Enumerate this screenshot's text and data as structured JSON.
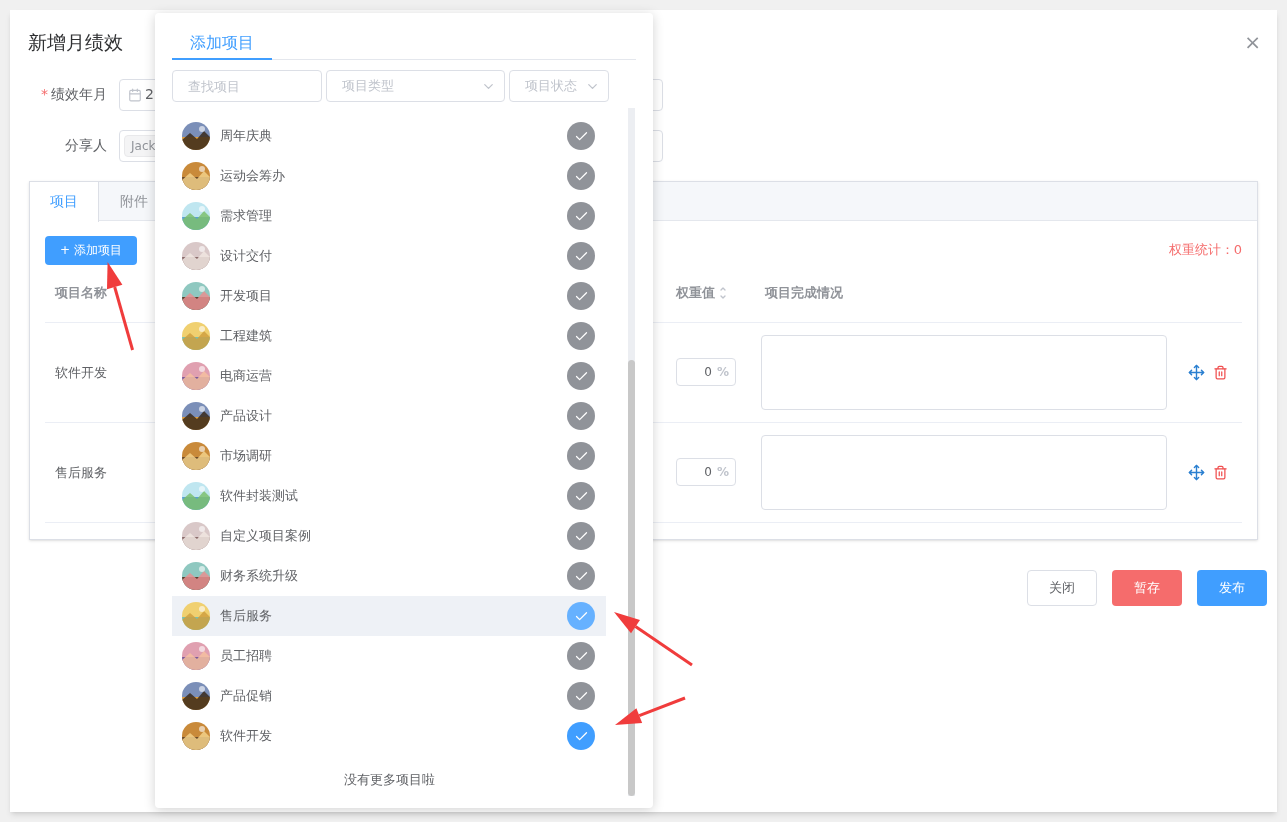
{
  "dialog": {
    "title": "新增月绩效",
    "close": "×"
  },
  "form": {
    "fields": [
      {
        "label": "绩效年月",
        "required_mark": "*",
        "kind": "date",
        "value": "2"
      },
      {
        "label": "分享人",
        "kind": "tags",
        "tags": [
          "Jack"
        ]
      }
    ]
  },
  "tabs": [
    {
      "label": "项目",
      "selected": true
    },
    {
      "label": "附件",
      "selected": false
    }
  ],
  "add_button": "添加项目",
  "add_icon": "+",
  "weight_total": "权重统计：0",
  "table": {
    "columns": [
      {
        "label": "项目名称",
        "sortable": false
      },
      {
        "label": "权重值",
        "sortable": true
      },
      {
        "label": "项目完成情况",
        "sortable": false
      }
    ],
    "rows": [
      {
        "name": "软件开发",
        "weight": "0",
        "unit": "%"
      },
      {
        "name": "售后服务",
        "weight": "0",
        "unit": "%"
      }
    ]
  },
  "footer": [
    {
      "label": "关闭",
      "kind": "default"
    },
    {
      "label": "暂存",
      "kind": "danger"
    },
    {
      "label": "发布",
      "kind": "primary"
    }
  ],
  "popover": {
    "tab": "添加项目",
    "search": {
      "placeholder": "查找项目"
    },
    "filters": [
      {
        "placeholder": "项目类型"
      },
      {
        "placeholder": "项目状态"
      }
    ],
    "items": [
      {
        "name": "周年庆典",
        "color": "#909399",
        "hovered": false
      },
      {
        "name": "运动会筹办",
        "color": "#909399",
        "hovered": false
      },
      {
        "name": "需求管理",
        "color": "#909399",
        "hovered": false
      },
      {
        "name": "设计交付",
        "color": "#909399",
        "hovered": false
      },
      {
        "name": "开发项目",
        "color": "#909399",
        "hovered": false
      },
      {
        "name": "工程建筑",
        "color": "#909399",
        "hovered": false
      },
      {
        "name": "电商运营",
        "color": "#909399",
        "hovered": false
      },
      {
        "name": "产品设计",
        "color": "#909399",
        "hovered": false
      },
      {
        "name": "市场调研",
        "color": "#909399",
        "hovered": false
      },
      {
        "name": "软件封装测试",
        "color": "#909399",
        "hovered": false
      },
      {
        "name": "自定义项目案例",
        "color": "#909399",
        "hovered": false
      },
      {
        "name": "财务系统升级",
        "color": "#909399",
        "hovered": false
      },
      {
        "name": "售后服务",
        "color": "#66b1ff",
        "hovered": true
      },
      {
        "name": "员工招聘",
        "color": "#909399",
        "hovered": false
      },
      {
        "name": "产品促销",
        "color": "#909399",
        "hovered": false
      },
      {
        "name": "软件开发",
        "color": "#409eff",
        "hovered": false
      }
    ],
    "footer_note": "没有更多项目啦"
  }
}
